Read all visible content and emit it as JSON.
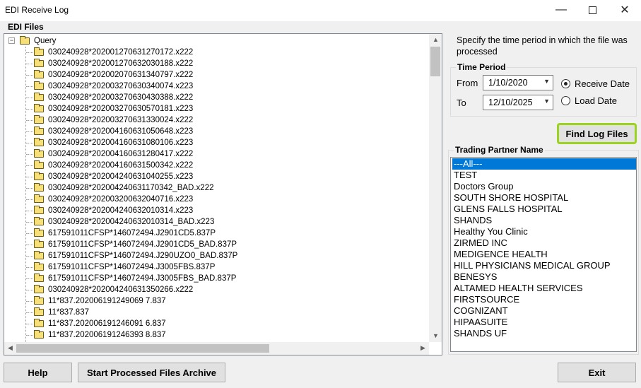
{
  "window": {
    "title": "EDI Receive Log"
  },
  "edi_files": {
    "label": "EDI Files",
    "root": "Query",
    "files": [
      "030240928*202001270631270172.x222",
      "030240928*202001270632030188.x222",
      "030240928*202002070631340797.x222",
      "030240928*202003270630340074.x223",
      "030240928*202003270630430388.x222",
      "030240928*202003270630570181.x223",
      "030240928*202003270631330024.x222",
      "030240928*202004160631050648.x223",
      "030240928*202004160631080106.x223",
      "030240928*202004160631280417.x222",
      "030240928*202004160631500342.x222",
      "030240928*202004240631040255.x223",
      "030240928*202004240631170342_BAD.x222",
      "030240928*202003200632040716.x223",
      "030240928*202004240632010314.x223",
      "030240928*202004240632010314_BAD.x223",
      "617591011CFSP*146072494.J2901CD5.837P",
      "617591011CFSP*146072494.J2901CD5_BAD.837P",
      "617591011CFSP*146072494.J290UZO0_BAD.837P",
      "617591011CFSP*146072494.J3005FBS.837P",
      "617591011CFSP*146072494.J3005FBS_BAD.837P",
      "030240928*202004240631350266.x222",
      "11*837.202006191249069 7.837",
      "11*837.837",
      "11*837.202006191246091 6.837",
      "11*837.202006191246393 8.837"
    ]
  },
  "time_period": {
    "instruction": "Specify the time period in which the file was processed",
    "legend": "Time Period",
    "from_label": "From",
    "from_value": "1/10/2020",
    "to_label": "To",
    "to_value": "12/10/2025",
    "receive_date_label": "Receive Date",
    "load_date_label": "Load Date",
    "selected": "receive"
  },
  "find_log_files_label": "Find Log Files",
  "trading_partner": {
    "legend": "Trading Partner Name",
    "items": [
      "---All---",
      "TEST",
      "Doctors Group",
      "SOUTH SHORE HOSPITAL",
      "GLENS FALLS HOSPITAL",
      "SHANDS",
      "Healthy You Clinic",
      "ZIRMED INC",
      "MEDIGENCE HEALTH",
      "HILL PHYSICIANS MEDICAL GROUP",
      "BENESYS",
      "ALTAMED HEALTH SERVICES",
      "FIRSTSOURCE",
      "COGNIZANT",
      "HIPAASUITE",
      "SHANDS UF"
    ],
    "selected_index": 0
  },
  "buttons": {
    "help": "Help",
    "archive": "Start Processed Files Archive",
    "exit": "Exit"
  },
  "colors": {
    "highlight_border": "#9bd31e",
    "selection": "#0078d7"
  }
}
